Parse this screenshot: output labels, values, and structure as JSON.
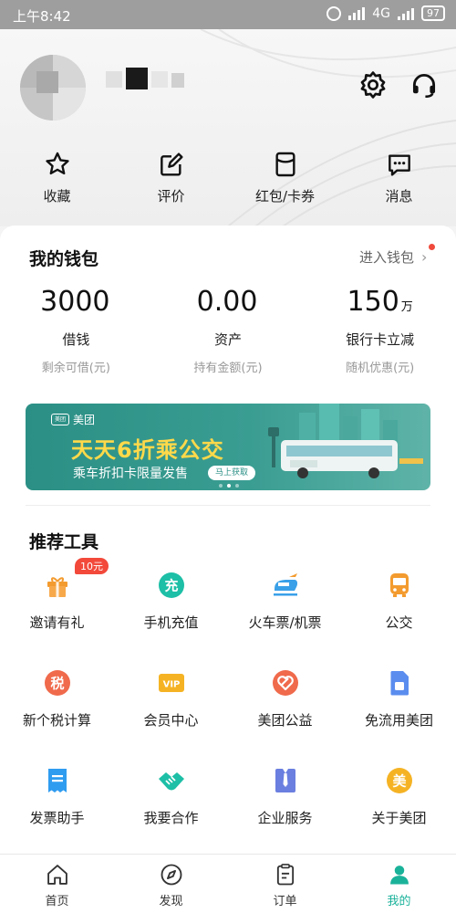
{
  "status_bar": {
    "time": "上午8:42",
    "network": "4G",
    "battery": "97"
  },
  "profile": {
    "avatar": "avatar",
    "username": ""
  },
  "header_actions": [
    {
      "name": "settings",
      "icon": "gear-icon"
    },
    {
      "name": "customer-service",
      "icon": "headset-icon"
    }
  ],
  "shortcuts": [
    {
      "label": "收藏",
      "icon": "star-icon"
    },
    {
      "label": "评价",
      "icon": "edit-icon"
    },
    {
      "label": "红包/卡券",
      "icon": "coupon-icon"
    },
    {
      "label": "消息",
      "icon": "message-icon"
    }
  ],
  "wallet": {
    "title": "我的钱包",
    "enter_label": "进入钱包",
    "stats": [
      {
        "value": "3000",
        "unit": "",
        "label": "借钱",
        "sub": "剩余可借(元)"
      },
      {
        "value": "0.00",
        "unit": "",
        "label": "资产",
        "sub": "持有金额(元)"
      },
      {
        "value": "150",
        "unit": "万",
        "label": "银行卡立减",
        "sub": "随机优惠(元)"
      }
    ]
  },
  "banner": {
    "brand": "美团",
    "headline": "天天6折乘公交",
    "subtitle": "乘车折扣卡限量发售",
    "button": "马上获取",
    "slide_count": 3,
    "active_slide": 2
  },
  "tools": {
    "title": "推荐工具",
    "items": [
      {
        "label": "邀请有礼",
        "icon": "gift-icon",
        "color": "#f39b2f",
        "badge": "10元"
      },
      {
        "label": "手机充值",
        "icon": "recharge-icon",
        "color": "#1dbfa6"
      },
      {
        "label": "火车票/机票",
        "icon": "train-icon",
        "color": "#3aa0e8"
      },
      {
        "label": "公交",
        "icon": "bus-icon",
        "color": "#f39b2f"
      },
      {
        "label": "新个税计算",
        "icon": "tax-icon",
        "color": "#f06a4c"
      },
      {
        "label": "会员中心",
        "icon": "vip-icon",
        "color": "#f5b324"
      },
      {
        "label": "美团公益",
        "icon": "charity-icon",
        "color": "#f06a4c"
      },
      {
        "label": "免流用美团",
        "icon": "sim-card-icon",
        "color": "#5b8def"
      },
      {
        "label": "发票助手",
        "icon": "invoice-icon",
        "color": "#2f9cf0"
      },
      {
        "label": "我要合作",
        "icon": "handshake-icon",
        "color": "#1dbfa6"
      },
      {
        "label": "企业服务",
        "icon": "enterprise-icon",
        "color": "#6b7fe0"
      },
      {
        "label": "关于美团",
        "icon": "meituan-logo-icon",
        "color": "#f5b324",
        "glyph": "美"
      }
    ]
  },
  "tabbar": {
    "tabs": [
      {
        "label": "首页",
        "icon": "home-icon"
      },
      {
        "label": "发现",
        "icon": "compass-icon"
      },
      {
        "label": "订单",
        "icon": "order-icon"
      },
      {
        "label": "我的",
        "icon": "profile-icon"
      }
    ],
    "active": 3
  },
  "colors": {
    "accent": "#1bb29a",
    "badge_red": "#f2493b",
    "banner_teal": "#2b8f85",
    "banner_yellow": "#ffd94a"
  }
}
